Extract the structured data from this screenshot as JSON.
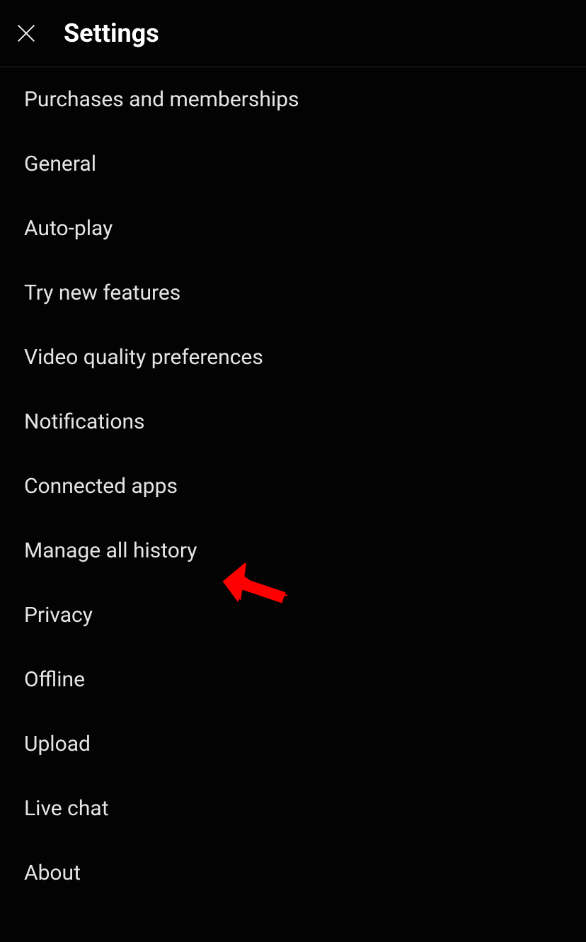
{
  "header": {
    "title": "Settings"
  },
  "settings": {
    "items": [
      {
        "label": "Purchases and memberships"
      },
      {
        "label": "General"
      },
      {
        "label": "Auto-play"
      },
      {
        "label": "Try new features"
      },
      {
        "label": "Video quality preferences"
      },
      {
        "label": "Notifications"
      },
      {
        "label": "Connected apps"
      },
      {
        "label": "Manage all history"
      },
      {
        "label": "Privacy"
      },
      {
        "label": "Offline"
      },
      {
        "label": "Upload"
      },
      {
        "label": "Live chat"
      },
      {
        "label": "About"
      }
    ]
  },
  "annotation": {
    "arrow_color": "#ff0000",
    "target_item_index": 7
  }
}
